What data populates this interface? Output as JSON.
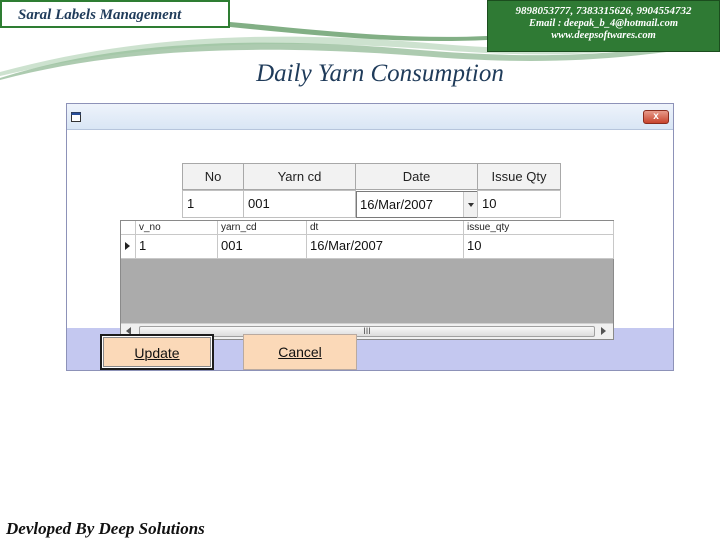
{
  "header": {
    "app_title": "Saral Labels Management",
    "contact_phones": "9898053777, 7383315626, 9904554732",
    "contact_email": "Email : deepak_b_4@hotmail.com",
    "contact_web": "www.deepsoftwares.com"
  },
  "page_title": "Daily Yarn Consumption",
  "window": {
    "close_label": "x"
  },
  "form": {
    "headers": [
      "No",
      "Yarn cd",
      "Date",
      "Issue Qty"
    ],
    "values": {
      "no": "1",
      "yarn_cd": "001",
      "date": "16/Mar/2007",
      "issue_qty": "10"
    }
  },
  "grid": {
    "columns": [
      "v_no",
      "yarn_cd",
      "dt",
      "issue_qty"
    ],
    "rows": [
      [
        "1",
        "001",
        "16/Mar/2007",
        "10"
      ]
    ],
    "scroll_thumb_label": "III"
  },
  "buttons": {
    "update": "Update",
    "cancel": "Cancel"
  },
  "footer": "Devloped By Deep Solutions",
  "colors": {
    "brand_green": "#2f7a34",
    "title_blue": "#1f3b5a",
    "window_bg": "#c4c8f0",
    "button_bg": "#fbd9b8"
  }
}
